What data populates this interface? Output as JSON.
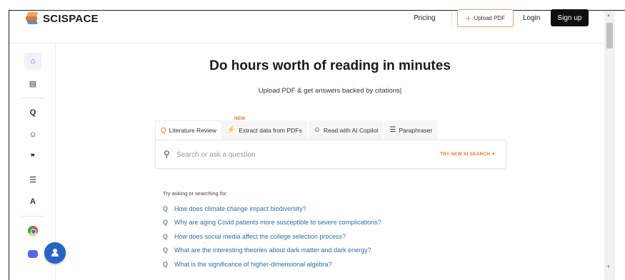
{
  "header": {
    "logo_text": "SCISPACE",
    "pricing": "Pricing",
    "upload_button": "Upload PDF",
    "login": "Login",
    "signup": "Sign up"
  },
  "sidebar": {
    "items": [
      {
        "icon": "home-icon",
        "glyph": "⌂"
      },
      {
        "icon": "book-icon",
        "glyph": "▤"
      },
      {
        "icon": "search-icon",
        "glyph": "Q"
      },
      {
        "icon": "chat-icon",
        "glyph": "☺"
      },
      {
        "icon": "quote-icon",
        "glyph": "❞"
      },
      {
        "icon": "list-icon",
        "glyph": "☰"
      },
      {
        "icon": "text-style-icon",
        "glyph": "A"
      }
    ]
  },
  "hero": {
    "title": "Do hours worth of reading in minutes",
    "subtitle": "Upload PDF & get answers backed by citations|"
  },
  "tabs": [
    {
      "label": "Literature Review",
      "icon": "search-icon",
      "glyph": "Q",
      "active": true
    },
    {
      "label": "Extract data from PDFs",
      "icon": "bolt-icon",
      "glyph": "⚡",
      "active": false
    },
    {
      "label": "Read with AI Copilot",
      "icon": "chat-icon",
      "glyph": "☺",
      "active": false
    },
    {
      "label": "Paraphraser",
      "icon": "list-icon",
      "glyph": "☰",
      "active": false
    }
  ],
  "new_badge": "NEW",
  "search": {
    "placeholder": "Search or ask a question",
    "try_ai": "TRY NEW AI SEARCH ✦"
  },
  "suggestions": {
    "label": "Try asking or searching for:",
    "items": [
      "How does climate change impact biodiversity?",
      "Why are aging Covid patients more susceptible to severe complications?",
      "How does social media affect the college selection process?",
      "What are the interesting theories about dark matter and dark energy?",
      "What is the significance of higher-dimensional algebra?"
    ]
  },
  "colors": {
    "accent": "#e8782a",
    "link": "#2a6fa8",
    "fab": "#2563c9",
    "signup_bg": "#0f0f0f"
  }
}
